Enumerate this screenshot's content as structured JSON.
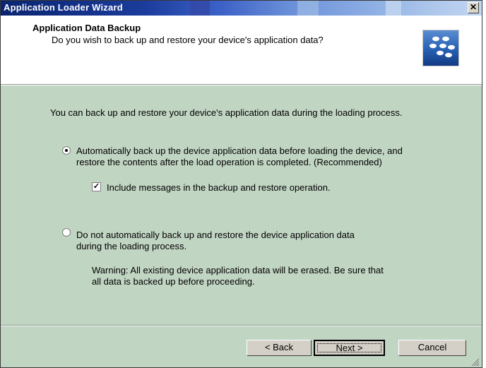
{
  "window": {
    "title": "Application Loader Wizard"
  },
  "header": {
    "title": "Application Data Backup",
    "subtitle": "Do you wish to back up and restore your device's application data?",
    "logo_icon": "blackberry-logo-icon"
  },
  "body": {
    "intro": "You can back up and restore your device's application data during the loading process.",
    "option_auto": {
      "selected": true,
      "line1": "Automatically back up the device application data before loading the device, and",
      "line2": "restore the contents after the load operation is completed.  (Recommended)"
    },
    "include_messages": {
      "checked": true,
      "label": "Include messages in the backup and restore operation."
    },
    "option_manual": {
      "selected": false,
      "line1": "Do not automatically back up and restore the device application data",
      "line2": "during the loading process."
    },
    "warning": {
      "line1": "Warning: All existing device application data will be erased. Be sure that",
      "line2": "all data is backed up before proceeding."
    }
  },
  "footer": {
    "back_label": "< Back",
    "next_label": "Next >",
    "cancel_label": "Cancel"
  },
  "colors": {
    "panel_bg": "#c1d5c3",
    "titlebar_start": "#0a2470",
    "titlebar_end": "#c3d6f2"
  }
}
